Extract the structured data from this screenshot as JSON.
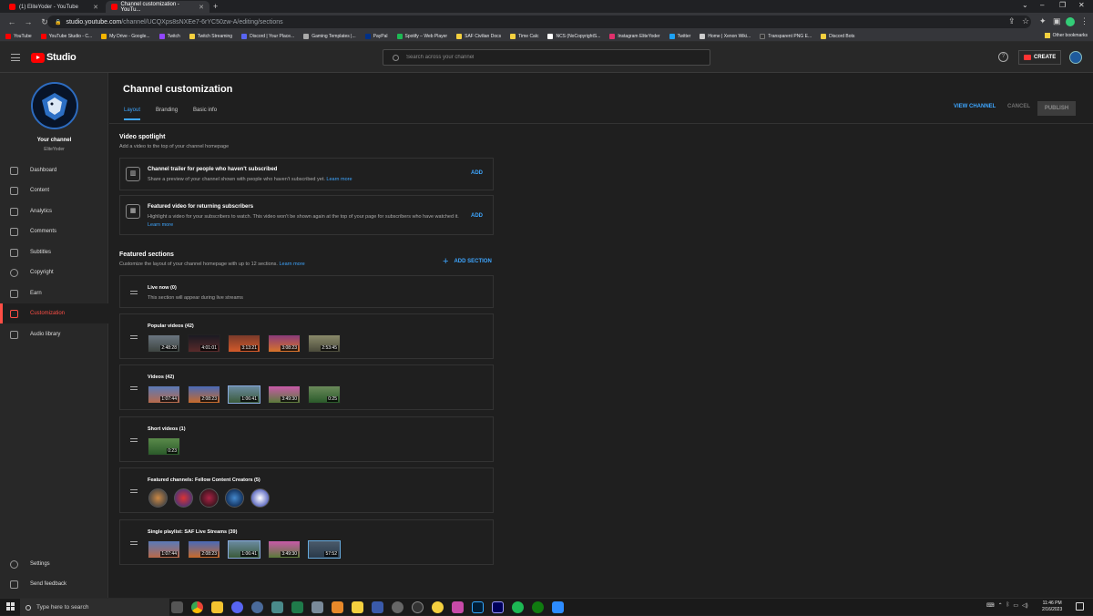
{
  "browser": {
    "tabs": [
      {
        "title": "(1) EliteYoder - YouTube",
        "active": false
      },
      {
        "title": "Channel customization - YouTu...",
        "active": true
      }
    ],
    "url_host": "studio.youtube.com",
    "url_path": "/channel/UCQXps8sNXEe7-6rYC50zw-A/editing/sections",
    "bookmarks": [
      {
        "label": "YouTube",
        "color": "#ff0000"
      },
      {
        "label": "YouTube Studio - C...",
        "color": "#ff0000"
      },
      {
        "label": "My Drive - Google...",
        "color": "#f4b400"
      },
      {
        "label": "Twitch",
        "color": "#9146ff"
      },
      {
        "label": "Twitch Streaming",
        "color": "#f4d03f"
      },
      {
        "label": "Discord | Your Place...",
        "color": "#5865f2"
      },
      {
        "label": "Gaming Templates |...",
        "color": "#aaaaaa"
      },
      {
        "label": "PayPal",
        "color": "#003087"
      },
      {
        "label": "Spotify – Web Player",
        "color": "#1db954"
      },
      {
        "label": "SAF Civilian Docs",
        "color": "#f4d03f"
      },
      {
        "label": "Time Calc",
        "color": "#f4d03f"
      },
      {
        "label": "NCS (NoCopyrightS...",
        "color": "#ffffff"
      },
      {
        "label": "Instagram EliteYoder",
        "color": "#e1306c"
      },
      {
        "label": "Twitter",
        "color": "#1da1f2"
      },
      {
        "label": "Home | Xenon Wiki...",
        "color": "#cccccc"
      },
      {
        "label": "Transparent PNG E...",
        "color": "#333333"
      },
      {
        "label": "Discord Bots",
        "color": "#f4d03f"
      }
    ],
    "other_bookmarks": "Other bookmarks"
  },
  "header": {
    "logo_text": "Studio",
    "search_placeholder": "Search across your channel",
    "create_label": "CREATE"
  },
  "sidebar": {
    "channel_title": "Your channel",
    "channel_name": "EliteYoder",
    "items": [
      {
        "label": "Dashboard",
        "active": false
      },
      {
        "label": "Content",
        "active": false
      },
      {
        "label": "Analytics",
        "active": false
      },
      {
        "label": "Comments",
        "active": false
      },
      {
        "label": "Subtitles",
        "active": false
      },
      {
        "label": "Copyright",
        "active": false
      },
      {
        "label": "Earn",
        "active": false
      },
      {
        "label": "Customization",
        "active": true
      },
      {
        "label": "Audio library",
        "active": false
      }
    ],
    "bottom_items": [
      {
        "label": "Settings"
      },
      {
        "label": "Send feedback"
      }
    ]
  },
  "main": {
    "title": "Channel customization",
    "tabs": [
      {
        "label": "Layout",
        "active": true
      },
      {
        "label": "Branding",
        "active": false
      },
      {
        "label": "Basic info",
        "active": false
      }
    ],
    "view_channel": "VIEW CHANNEL",
    "cancel": "CANCEL",
    "publish": "PUBLISH",
    "video_spotlight": {
      "title": "Video spotlight",
      "subtitle": "Add a video to the top of your channel homepage",
      "trailer": {
        "title": "Channel trailer for people who haven't subscribed",
        "desc": "Share a preview of your channel shown with people who haven't subscribed yet.",
        "learn_more": "Learn more",
        "add": "ADD"
      },
      "featured": {
        "title": "Featured video for returning subscribers",
        "desc": "Highlight a video for your subscribers to watch. This video won't be shown again at the top of your page for subscribers who have watched it.",
        "learn_more": "Learn more",
        "add": "ADD"
      }
    },
    "featured_sections": {
      "title": "Featured sections",
      "subtitle": "Customize the layout of your channel homepage with up to 12 sections.",
      "learn_more": "Learn more",
      "add_section": "ADD SECTION",
      "live_now": {
        "title": "Live now (0)",
        "desc": "This section will appear during live streams"
      },
      "popular": {
        "title": "Popular videos (42)",
        "durations": [
          "2:48:28",
          "4:01:01",
          "3:13:21",
          "3:08:23",
          "2:53:45"
        ]
      },
      "videos": {
        "title": "Videos (42)",
        "durations": [
          "1:07:44",
          "2:08:23",
          "1:06:41",
          "3:49:30",
          "0:25"
        ]
      },
      "shorts": {
        "title": "Short videos (1)",
        "durations": [
          "0:23"
        ]
      },
      "channels": {
        "title": "Featured channels: Fellow Content Creators (5)"
      },
      "playlist": {
        "title": "Single playlist: SAF Live Streams (39)",
        "durations": [
          "1:07:44",
          "2:08:23",
          "1:06:41",
          "3:49:30",
          "57:52"
        ]
      }
    }
  },
  "taskbar": {
    "search_placeholder": "Type here to search",
    "time": "11:46 PM",
    "date": "2/16/2023"
  },
  "colors": {
    "accent": "#3ea6ff",
    "active_nav": "#ff4e45",
    "brand_red": "#ff0000"
  }
}
